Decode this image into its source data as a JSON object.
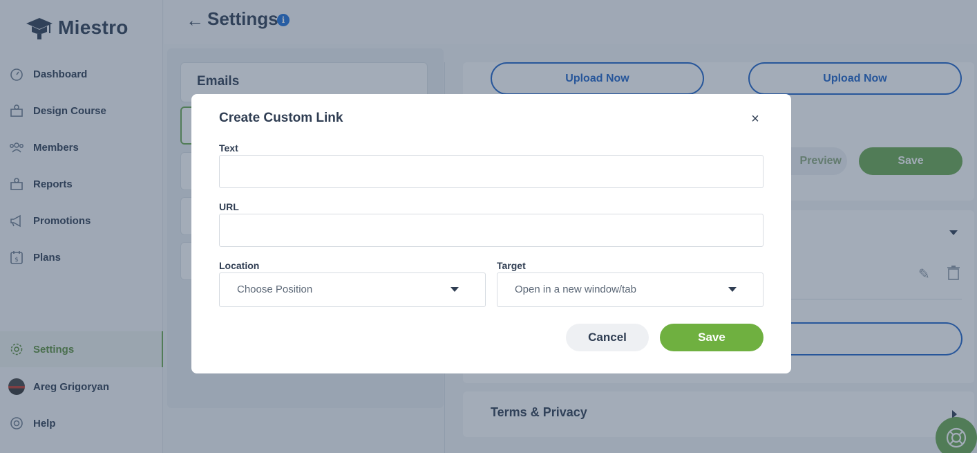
{
  "app": {
    "name": "Miestro"
  },
  "header": {
    "title": "Settings",
    "info_icon": "info-icon"
  },
  "sidebar": {
    "items": [
      {
        "label": "Dashboard",
        "icon": "dashboard-icon"
      },
      {
        "label": "Design Course",
        "icon": "design-course-icon"
      },
      {
        "label": "Members",
        "icon": "members-icon"
      },
      {
        "label": "Reports",
        "icon": "reports-icon"
      },
      {
        "label": "Promotions",
        "icon": "megaphone-icon"
      },
      {
        "label": "Plans",
        "icon": "plans-icon"
      }
    ],
    "settings": {
      "label": "Settings",
      "icon": "gear-icon",
      "active": true
    },
    "user": {
      "label": "Areg Grigoryan"
    },
    "help": {
      "label": "Help",
      "icon": "lifebuoy-icon"
    }
  },
  "background": {
    "emails_title": "Emails",
    "upload_1": "Upload Now",
    "upload_2": "Upload Now",
    "preview": "Preview",
    "save": "Save",
    "terms_title": "Terms & Privacy"
  },
  "modal": {
    "title": "Create Custom Link",
    "close": "×",
    "text_label": "Text",
    "text_value": "",
    "url_label": "URL",
    "url_value": "",
    "location_label": "Location",
    "location_value": "Choose Position",
    "target_label": "Target",
    "target_value": "Open in a new window/tab",
    "cancel": "Cancel",
    "save": "Save"
  },
  "colors": {
    "accent_green": "#6fb040",
    "link_blue": "#1e63c9",
    "info_blue": "#1e6fd9"
  }
}
